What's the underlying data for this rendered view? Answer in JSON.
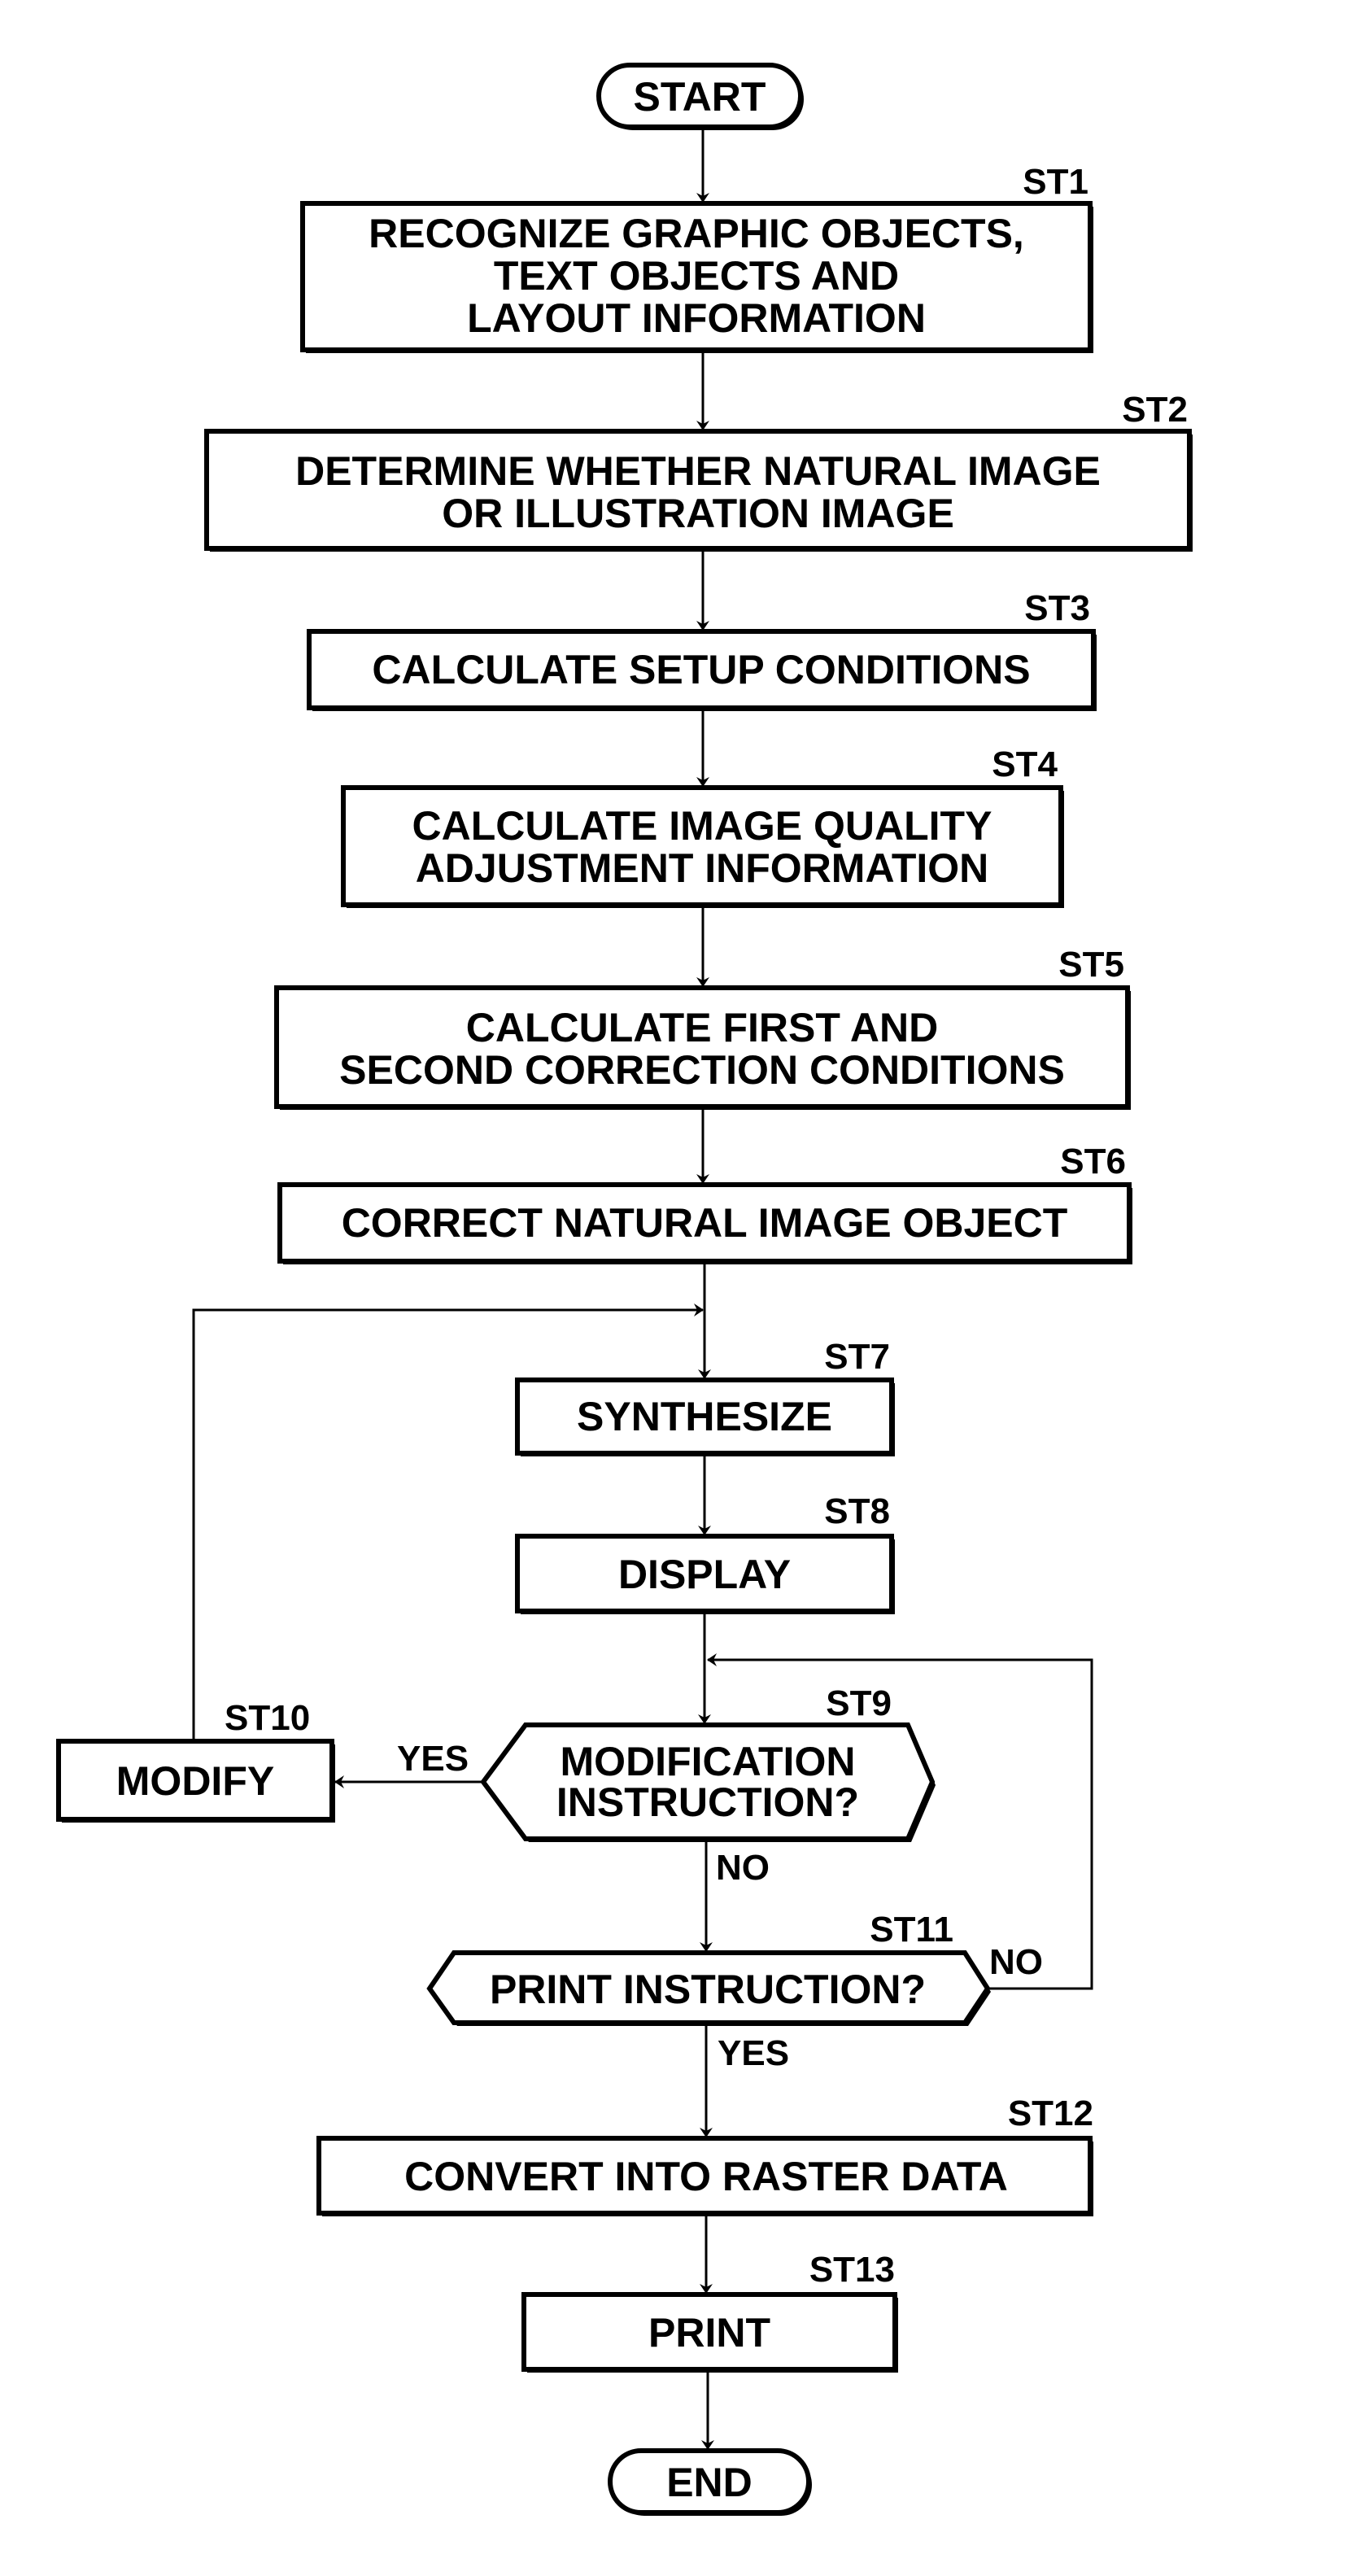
{
  "diagram": {
    "type": "flowchart",
    "start": "START",
    "end": "END",
    "steps": [
      {
        "id": "ST1",
        "lines": [
          "RECOGNIZE GRAPHIC OBJECTS,",
          "TEXT OBJECTS AND",
          "LAYOUT INFORMATION"
        ]
      },
      {
        "id": "ST2",
        "lines": [
          "DETERMINE WHETHER NATURAL IMAGE",
          "OR ILLUSTRATION IMAGE"
        ]
      },
      {
        "id": "ST3",
        "lines": [
          "CALCULATE SETUP CONDITIONS"
        ]
      },
      {
        "id": "ST4",
        "lines": [
          "CALCULATE IMAGE QUALITY",
          "ADJUSTMENT INFORMATION"
        ]
      },
      {
        "id": "ST5",
        "lines": [
          "CALCULATE FIRST AND",
          "SECOND CORRECTION CONDITIONS"
        ]
      },
      {
        "id": "ST6",
        "lines": [
          "CORRECT NATURAL IMAGE OBJECT"
        ]
      },
      {
        "id": "ST7",
        "lines": [
          "SYNTHESIZE"
        ]
      },
      {
        "id": "ST8",
        "lines": [
          "DISPLAY"
        ]
      },
      {
        "id": "ST9",
        "lines": [
          "MODIFICATION",
          "INSTRUCTION?"
        ],
        "kind": "decision"
      },
      {
        "id": "ST10",
        "lines": [
          "MODIFY"
        ]
      },
      {
        "id": "ST11",
        "lines": [
          "PRINT INSTRUCTION?"
        ],
        "kind": "decision"
      },
      {
        "id": "ST12",
        "lines": [
          "CONVERT INTO RASTER DATA"
        ]
      },
      {
        "id": "ST13",
        "lines": [
          "PRINT"
        ]
      }
    ],
    "branch_labels": {
      "st9_yes": "YES",
      "st9_no": "NO",
      "st11_no": "NO",
      "st11_yes": "YES"
    }
  }
}
